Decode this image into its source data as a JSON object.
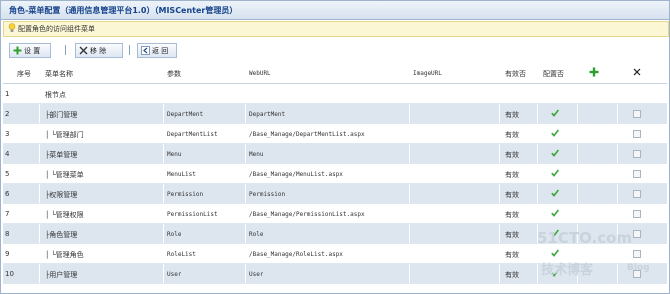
{
  "window": {
    "title": "角色-菜单配置（通用信息管理平台1.0）（MISCenter管理员）"
  },
  "hint": {
    "text": "配置角色的访问组件菜单",
    "icon": "lightbulb-icon"
  },
  "toolbar": {
    "set_label": "设 置",
    "remove_label": "移 除",
    "back_label": "返 回",
    "set_icon": "add-icon",
    "remove_icon": "remove-icon",
    "back_icon": "back-icon"
  },
  "table": {
    "headers": {
      "index": "序号",
      "name": "菜单名称",
      "param": "参数",
      "weburl": "WebURL",
      "imageurl": "ImageURL",
      "valid": "有效否",
      "configured": "配置否",
      "add_icon": "add-icon",
      "delete_icon": "close-icon"
    },
    "rows": [
      {
        "index": "1",
        "name": "根节点",
        "param": "",
        "weburl": "",
        "valid": "",
        "configured": false,
        "checkbox": false
      },
      {
        "index": "2",
        "name": "├部门管理",
        "param": "DepartMent",
        "weburl": "DepartMent",
        "valid": "有效",
        "configured": true,
        "checkbox": true
      },
      {
        "index": "3",
        "name": "│ └管理部门",
        "param": "DepartMentList",
        "weburl": "/Base_Manage/DepartMentList.aspx",
        "valid": "有效",
        "configured": true,
        "checkbox": true
      },
      {
        "index": "4",
        "name": "├菜单管理",
        "param": "Menu",
        "weburl": "Menu",
        "valid": "有效",
        "configured": true,
        "checkbox": true
      },
      {
        "index": "5",
        "name": "│ └管理菜单",
        "param": "MenuList",
        "weburl": "/Base_Manage/MenuList.aspx",
        "valid": "有效",
        "configured": true,
        "checkbox": true
      },
      {
        "index": "6",
        "name": "├权限管理",
        "param": "Permission",
        "weburl": "Permission",
        "valid": "有效",
        "configured": true,
        "checkbox": true
      },
      {
        "index": "7",
        "name": "│ └管理权限",
        "param": "PermissionList",
        "weburl": "/Base_Manage/PermissionList.aspx",
        "valid": "有效",
        "configured": true,
        "checkbox": true
      },
      {
        "index": "8",
        "name": "├角色管理",
        "param": "Role",
        "weburl": "Role",
        "valid": "有效",
        "configured": true,
        "checkbox": true
      },
      {
        "index": "9",
        "name": "│ └管理角色",
        "param": "RoleList",
        "weburl": "/Base_Manage/RoleList.aspx",
        "valid": "有效",
        "configured": true,
        "checkbox": true
      },
      {
        "index": "10",
        "name": "├用户管理",
        "param": "User",
        "weburl": "User",
        "valid": "有效",
        "configured": true,
        "checkbox": true
      }
    ]
  },
  "watermark": {
    "line1": "51CTO.com",
    "line2": "技术博客",
    "line3": "Blog"
  },
  "colors": {
    "check": "#3aa43a",
    "add": "#2f9e2f",
    "title": "#15428b",
    "alt_row": "#dde6ef"
  }
}
